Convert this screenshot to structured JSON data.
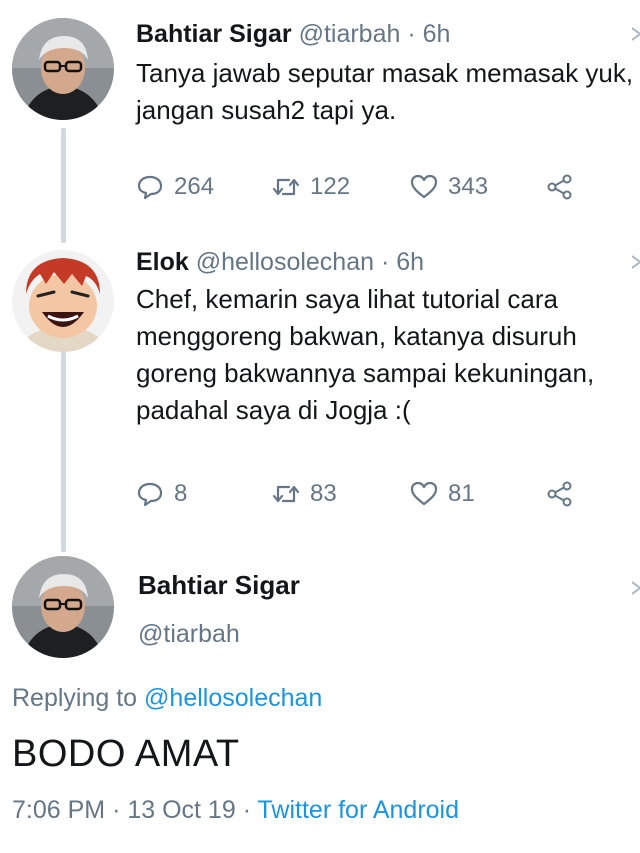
{
  "tweets": [
    {
      "name": "Bahtiar Sigar",
      "handle": "@tiarbah",
      "separator": "·",
      "time": "6h",
      "text": "Tanya jawab seputar masak memasak yuk, jangan susah2 tapi ya.",
      "replies": "264",
      "retweets": "122",
      "likes": "343"
    },
    {
      "name": "Elok",
      "handle": "@hellosolechan",
      "separator": "·",
      "time": "6h",
      "text": "Chef, kemarin saya lihat tutorial cara menggoreng bakwan, katanya disuruh goreng bakwannya sampai kekuningan, padahal saya di Jogja :(",
      "replies": "8",
      "retweets": "83",
      "likes": "81"
    }
  ],
  "main_tweet": {
    "name": "Bahtiar Sigar",
    "handle": "@tiarbah",
    "replying_prefix": "Replying to",
    "replying_handle": "@hellosolechan",
    "text": "BODO AMAT",
    "time": "7:06 PM",
    "separator": "·",
    "date": "13 Oct 19",
    "separator2": "·",
    "source": "Twitter for Android"
  },
  "icons": {
    "reply": "reply-icon",
    "retweet": "retweet-icon",
    "like": "heart-icon",
    "share": "share-icon",
    "more": "chevron-down-icon"
  },
  "colors": {
    "link": "#1b95e0",
    "muted": "#657786",
    "text": "#14171a",
    "thread_line": "#cfd9de"
  }
}
